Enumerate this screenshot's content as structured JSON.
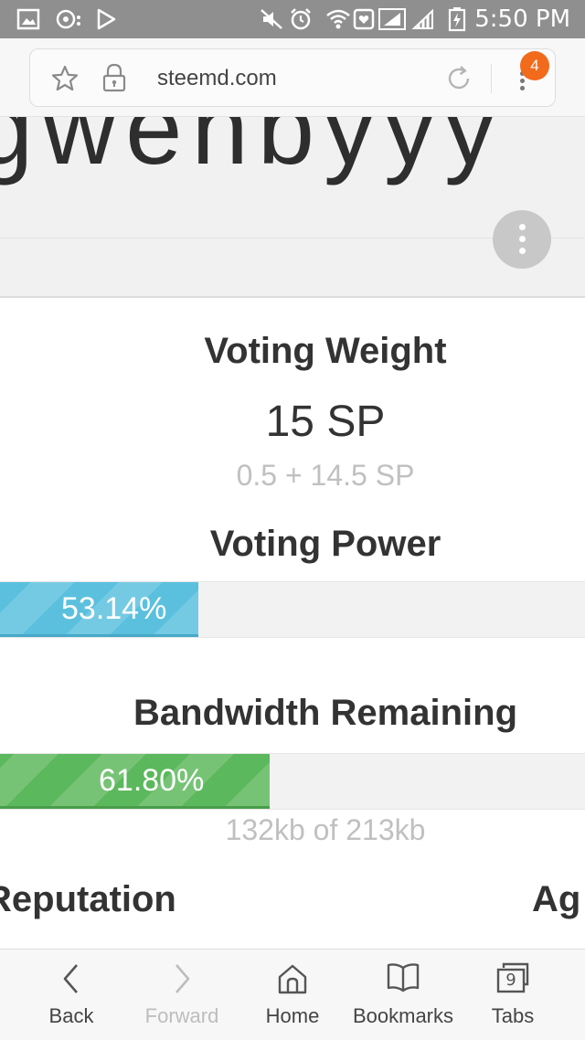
{
  "status_bar": {
    "time": "5:50 PM",
    "icons": [
      "gallery-icon",
      "notification-icon",
      "play-store-icon",
      "mute-icon",
      "alarm-icon",
      "wifi-icon",
      "heart-app-icon",
      "signal-icon",
      "signal-icon",
      "battery-charging-icon"
    ]
  },
  "browser": {
    "url": "steemd.com",
    "tabs_badge": "4"
  },
  "header": {
    "username_fragment": "gwenbyyy"
  },
  "voting_weight": {
    "title": "Voting Weight",
    "value": "15 SP",
    "breakdown": "0.5 + 14.5 SP"
  },
  "voting_power": {
    "title": "Voting Power",
    "percent": 53.14,
    "label": "53.14%",
    "color": "#5bc0de"
  },
  "bandwidth": {
    "title": "Bandwidth Remaining",
    "percent": 61.8,
    "label": "61.80%",
    "detail": "132kb of 213kb",
    "color": "#5cb85c"
  },
  "stats_row": {
    "reputation_label": "Reputation",
    "age_label": "Ag"
  },
  "bottom_nav": {
    "back": "Back",
    "forward": "Forward",
    "home": "Home",
    "bookmarks": "Bookmarks",
    "tabs": "Tabs",
    "tabs_count": "9"
  }
}
